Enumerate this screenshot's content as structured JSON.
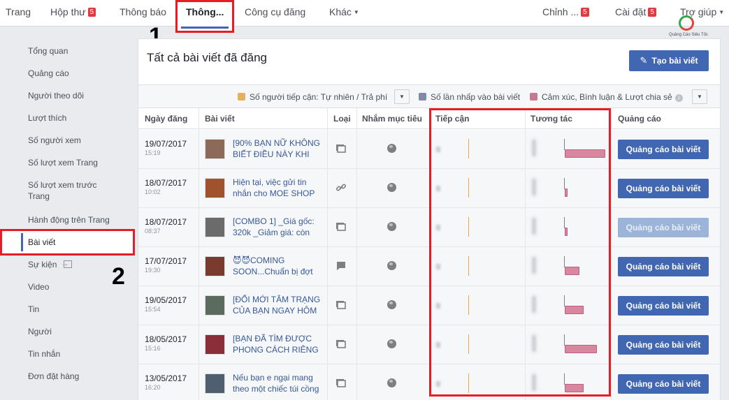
{
  "topnav": {
    "items": [
      {
        "label": "Trang"
      },
      {
        "label": "Hộp thư",
        "badge": "5"
      },
      {
        "label": "Thông báo"
      },
      {
        "label": "Thông..."
      },
      {
        "label": "Công cụ đăng"
      },
      {
        "label": "Khác"
      },
      {
        "label": "Chỉnh ...",
        "badge": "5"
      },
      {
        "label": "Cài đặt",
        "badge": "5"
      },
      {
        "label": "Trợ giúp"
      }
    ],
    "logo_caption": "Quảng Cáo Siêu Tốc"
  },
  "steps": {
    "one": "1",
    "two": "2"
  },
  "sidebar": {
    "items": [
      {
        "label": "Tổng quan"
      },
      {
        "label": "Quảng cáo"
      },
      {
        "label": "Người theo dõi"
      },
      {
        "label": "Lượt thích"
      },
      {
        "label": "Số người xem"
      },
      {
        "label": "Số lượt xem Trang"
      },
      {
        "label": "Số lượt xem trước"
      },
      {
        "label": "Trang"
      },
      {
        "label": "Hành động trên Trang"
      },
      {
        "label": "Bài viết"
      },
      {
        "label": "Sự kiện"
      },
      {
        "label": "Video"
      },
      {
        "label": "Tin"
      },
      {
        "label": "Người"
      },
      {
        "label": "Tin nhắn"
      },
      {
        "label": "Đơn đặt hàng"
      }
    ]
  },
  "main": {
    "title": "Tất cả bài viết đã đăng",
    "create_button": "Tạo bài viết",
    "legend": [
      {
        "label": "Số người tiếp cận: Tự nhiên / Trả phí",
        "color": "#e4b15c"
      },
      {
        "label": "Số lần nhấp vào bài viết",
        "color": "#8189a9"
      },
      {
        "label": "Cảm xúc, Bình luận & Lượt chia sẻ",
        "color": "#c47a8f"
      }
    ],
    "columns": {
      "date": "Ngày đăng",
      "post": "Bài viết",
      "type": "Loại",
      "targeting": "Nhắm mục tiêu",
      "reach": "Tiếp cận",
      "engagement": "Tương tác",
      "promote": "Quảng cáo"
    },
    "rows": [
      {
        "date": "19/07/2017",
        "time": "15:19",
        "text": "[90% BẠN NỮ KHÔNG BIẾT ĐIỀU NÀY KHI",
        "type": "album",
        "engagement_bar": 1.0,
        "button": "Quảng cáo bài viết",
        "button_enabled": true
      },
      {
        "date": "18/07/2017",
        "time": "10:02",
        "text": "Hiện tại, việc gửi tin nhắn cho MOE SHOP",
        "type": "link",
        "engagement_bar": 0.07,
        "button": "Quảng cáo bài viết",
        "button_enabled": true
      },
      {
        "date": "18/07/2017",
        "time": "08:37",
        "text": "[COMBO 1] _Giá gốc: 320k _Giảm giá: còn",
        "type": "album",
        "engagement_bar": 0.07,
        "button": "Quảng cáo bài viết",
        "button_enabled": false
      },
      {
        "date": "17/07/2017",
        "time": "19:30",
        "text": "😈😈COMING SOON...Chuẩn bị đợt",
        "type": "status",
        "engagement_bar": 0.37,
        "button": "Quảng cáo bài viết",
        "button_enabled": true
      },
      {
        "date": "19/05/2017",
        "time": "15:54",
        "text": "[ĐỔI MỚI TÂM TRẠNG CỦA BẠN NGAY HÔM",
        "type": "album",
        "engagement_bar": 0.47,
        "button": "Quảng cáo bài viết",
        "button_enabled": true
      },
      {
        "date": "18/05/2017",
        "time": "15:16",
        "text": "[BẠN ĐÃ TÌM ĐƯỢC PHONG CÁCH RIÊNG",
        "type": "album",
        "engagement_bar": 0.8,
        "button": "Quảng cáo bài viết",
        "button_enabled": true
      },
      {
        "date": "13/05/2017",
        "time": "16:20",
        "text": "Nếu bạn e ngại mang theo một chiếc túi cồng",
        "type": "album",
        "engagement_bar": 0.47,
        "button": "Quảng cáo bài viết",
        "button_enabled": true
      }
    ]
  }
}
